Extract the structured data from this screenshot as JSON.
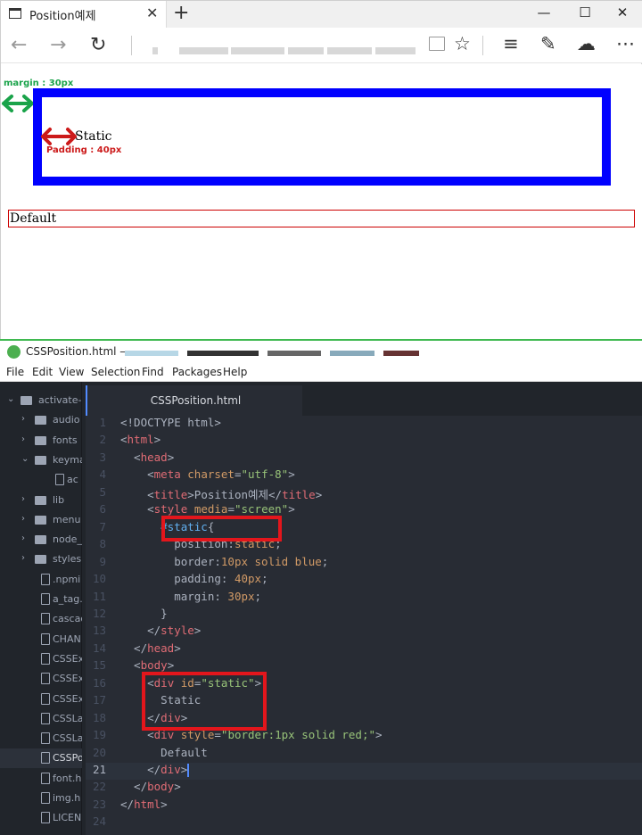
{
  "browser": {
    "tab_title": "Position예제",
    "tab_close": "✕",
    "new_tab": "+",
    "window_controls": {
      "minimize": "—",
      "maximize": "☐",
      "close": "✕"
    },
    "nav": {
      "back": "←",
      "forward": "→",
      "refresh": "↻"
    },
    "toolbar_icons": [
      "reading-view-icon",
      "favorite-star-icon",
      "hub-icon",
      "web-note-icon",
      "share-icon"
    ],
    "page": {
      "margin_annotation": "margin : 30px",
      "padding_annotation": "Padding : 40px",
      "static_text": "Static",
      "default_text": "Default"
    },
    "colors": {
      "static_border": "#0000ff",
      "default_border": "#cc0000",
      "margin_arrow": "#1aa34a",
      "padding_arrow": "#cc1a1a"
    }
  },
  "editor": {
    "window_title": "CSSPosition.html —",
    "menu": [
      "File",
      "Edit",
      "View",
      "Selection",
      "Find",
      "Packages",
      "Help"
    ],
    "active_tab": "CSSPosition.html",
    "tree": [
      {
        "type": "folder-open",
        "label": "activate-p",
        "depth": 0
      },
      {
        "type": "folder",
        "label": "audio",
        "depth": 1
      },
      {
        "type": "folder",
        "label": "fonts",
        "depth": 1
      },
      {
        "type": "folder-open",
        "label": "keyma",
        "depth": 1
      },
      {
        "type": "file",
        "label": "ac",
        "depth": 2
      },
      {
        "type": "folder",
        "label": "lib",
        "depth": 1
      },
      {
        "type": "folder",
        "label": "menu",
        "depth": 1
      },
      {
        "type": "folder",
        "label": "node_",
        "depth": 1
      },
      {
        "type": "folder",
        "label": "styles",
        "depth": 1
      },
      {
        "type": "file",
        "label": ".npmi",
        "depth": 1
      },
      {
        "type": "file",
        "label": "a_tag.",
        "depth": 1
      },
      {
        "type": "file",
        "label": "cascac",
        "depth": 1
      },
      {
        "type": "file",
        "label": "CHAN",
        "depth": 1
      },
      {
        "type": "file",
        "label": "CSSEx",
        "depth": 1
      },
      {
        "type": "file",
        "label": "CSSEx",
        "depth": 1
      },
      {
        "type": "file",
        "label": "CSSEx",
        "depth": 1
      },
      {
        "type": "file",
        "label": "CSSLa",
        "depth": 1
      },
      {
        "type": "file",
        "label": "CSSLa",
        "depth": 1
      },
      {
        "type": "file",
        "label": "CSSPo",
        "depth": 1,
        "selected": true
      },
      {
        "type": "file",
        "label": "font.h",
        "depth": 1
      },
      {
        "type": "file",
        "label": "img.h",
        "depth": 1
      },
      {
        "type": "file",
        "label": "LICEN",
        "depth": 1
      }
    ],
    "current_line": 21,
    "lines": [
      [
        [
          "t-punc",
          "<!DOCTYPE html>"
        ]
      ],
      [
        [
          "t-punc",
          "<"
        ],
        [
          "t-tag",
          "html"
        ],
        [
          "t-punc",
          ">"
        ]
      ],
      [
        [
          "t-punc",
          "  <"
        ],
        [
          "t-tag",
          "head"
        ],
        [
          "t-punc",
          ">"
        ]
      ],
      [
        [
          "t-punc",
          "    <"
        ],
        [
          "t-tag",
          "meta"
        ],
        [
          "t-punc",
          " "
        ],
        [
          "t-attr",
          "charset"
        ],
        [
          "t-punc",
          "="
        ],
        [
          "t-str",
          "\"utf-8\""
        ],
        [
          "t-punc",
          ">"
        ]
      ],
      [
        [
          "t-punc",
          "    <"
        ],
        [
          "t-tag",
          "title"
        ],
        [
          "t-punc",
          ">Position예제</"
        ],
        [
          "t-tag",
          "title"
        ],
        [
          "t-punc",
          ">"
        ]
      ],
      [
        [
          "t-punc",
          "    <"
        ],
        [
          "t-tag",
          "style"
        ],
        [
          "t-punc",
          " "
        ],
        [
          "t-attr",
          "media"
        ],
        [
          "t-punc",
          "="
        ],
        [
          "t-str",
          "\"screen\""
        ],
        [
          "t-punc",
          ">"
        ]
      ],
      [
        [
          "t-id",
          "      #static"
        ],
        [
          "t-punc",
          "{"
        ]
      ],
      [
        [
          "t-prop",
          "        position"
        ],
        [
          "t-punc",
          ":"
        ],
        [
          "t-kw",
          "static"
        ],
        [
          "t-punc",
          ";"
        ]
      ],
      [
        [
          "t-prop",
          "        border"
        ],
        [
          "t-punc",
          ":"
        ],
        [
          "t-num",
          "10px"
        ],
        [
          "t-kw",
          " solid blue"
        ],
        [
          "t-punc",
          ";"
        ]
      ],
      [
        [
          "t-prop",
          "        padding"
        ],
        [
          "t-punc",
          ": "
        ],
        [
          "t-num",
          "40px"
        ],
        [
          "t-punc",
          ";"
        ]
      ],
      [
        [
          "t-prop",
          "        margin"
        ],
        [
          "t-punc",
          ": "
        ],
        [
          "t-num",
          "30px"
        ],
        [
          "t-punc",
          ";"
        ]
      ],
      [
        [
          "t-punc",
          "      }"
        ]
      ],
      [
        [
          "t-punc",
          "    </"
        ],
        [
          "t-tag",
          "style"
        ],
        [
          "t-punc",
          ">"
        ]
      ],
      [
        [
          "t-punc",
          "  </"
        ],
        [
          "t-tag",
          "head"
        ],
        [
          "t-punc",
          ">"
        ]
      ],
      [
        [
          "t-punc",
          "  <"
        ],
        [
          "t-tag",
          "body"
        ],
        [
          "t-punc",
          ">"
        ]
      ],
      [
        [
          "t-punc",
          "    <"
        ],
        [
          "t-tag",
          "div"
        ],
        [
          "t-punc",
          " "
        ],
        [
          "t-attr",
          "id"
        ],
        [
          "t-punc",
          "="
        ],
        [
          "t-str",
          "\"static\""
        ],
        [
          "t-punc",
          ">"
        ]
      ],
      [
        [
          "t-punc",
          "      Static"
        ]
      ],
      [
        [
          "t-punc",
          "    </"
        ],
        [
          "t-tag",
          "div"
        ],
        [
          "t-punc",
          ">"
        ]
      ],
      [
        [
          "t-punc",
          "    <"
        ],
        [
          "t-tag",
          "div"
        ],
        [
          "t-punc",
          " "
        ],
        [
          "t-attr",
          "style"
        ],
        [
          "t-punc",
          "="
        ],
        [
          "t-str",
          "\"border:1px solid red;\""
        ],
        [
          "t-punc",
          ">"
        ]
      ],
      [
        [
          "t-punc",
          "      Default"
        ]
      ],
      [
        [
          "t-punc",
          "    </"
        ],
        [
          "t-tag",
          "div"
        ],
        [
          "t-punc",
          ">"
        ]
      ],
      [
        [
          "t-punc",
          "  </"
        ],
        [
          "t-tag",
          "body"
        ],
        [
          "t-punc",
          ">"
        ]
      ],
      [
        [
          "t-punc",
          "</"
        ],
        [
          "t-tag",
          "html"
        ],
        [
          "t-punc",
          ">"
        ]
      ],
      []
    ],
    "highlight_color": "#e3161c"
  }
}
